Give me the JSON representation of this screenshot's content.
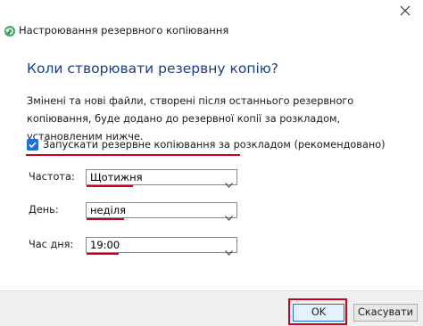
{
  "window": {
    "title": "Настроювання резервного копіювання",
    "icon": "backup-settings-icon"
  },
  "heading": "Коли створювати резервну копію?",
  "description": "Змінені та нові файли, створені після останнього резервного копіювання, буде додано до резервної копії за розкладом, установленим нижче.",
  "schedule_checkbox": {
    "label": "Запускати резервне копіювання за розкладом (рекомендовано)",
    "checked": true
  },
  "fields": [
    {
      "label": "Частота:",
      "value": "Щотижня"
    },
    {
      "label": "День:",
      "value": "неділя"
    },
    {
      "label": "Час дня:",
      "value": "19:00"
    }
  ],
  "buttons": {
    "ok": "OK",
    "cancel": "Скасувати"
  },
  "colors": {
    "accent": "#1f6fd6",
    "heading": "#1a3e8a",
    "highlight": "#d0001c"
  }
}
